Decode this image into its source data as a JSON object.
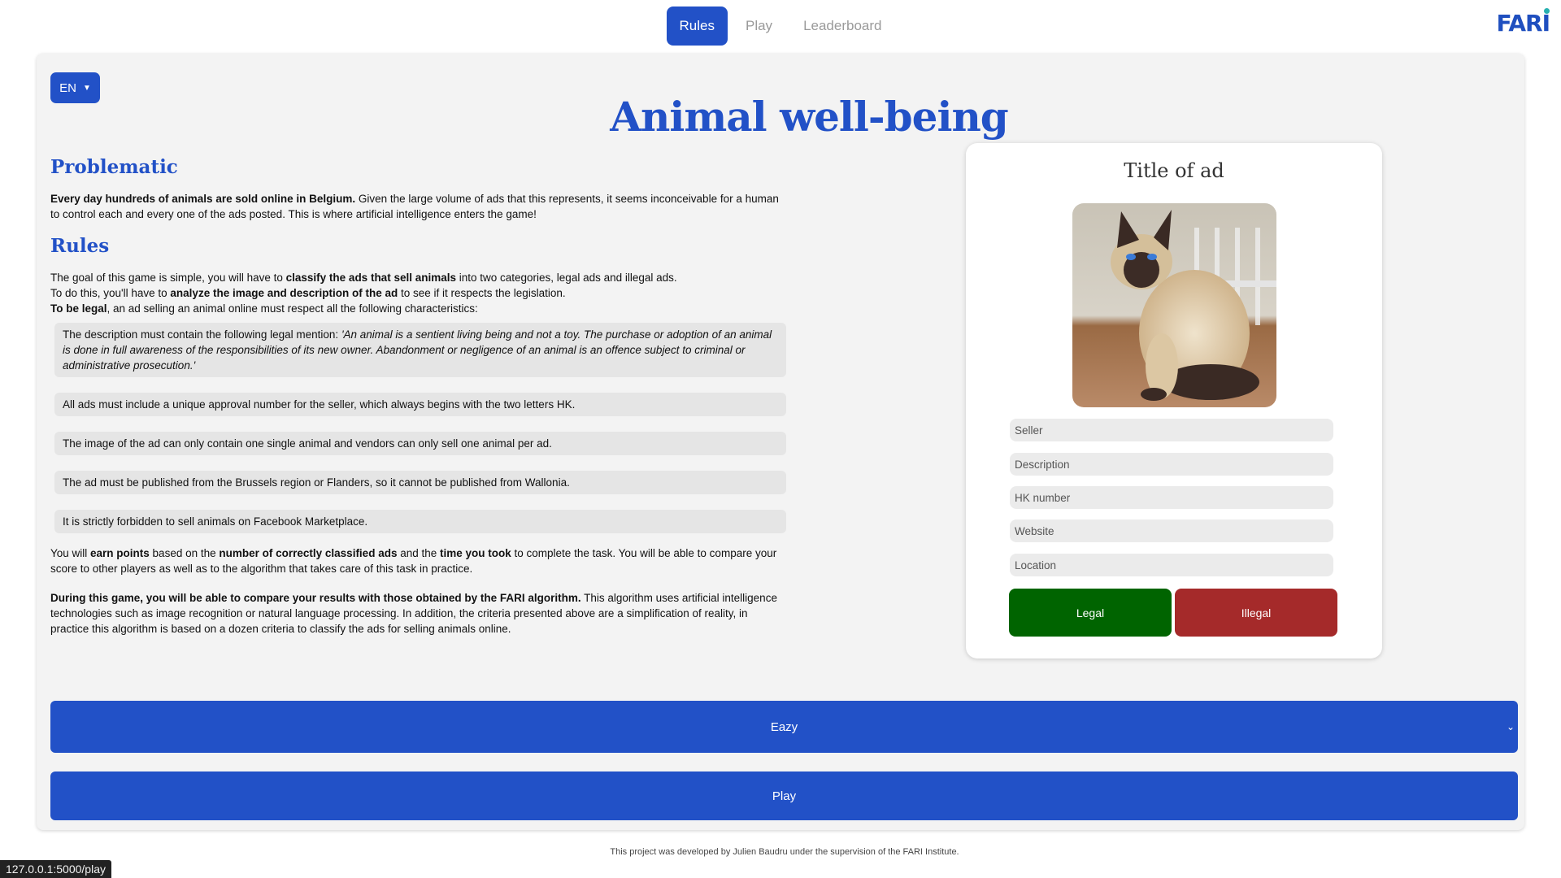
{
  "nav": {
    "tabs": [
      {
        "label": "Rules"
      },
      {
        "label": "Play"
      },
      {
        "label": "Leaderboard"
      }
    ],
    "logo": "FARI"
  },
  "page": {
    "language": "EN",
    "title": "Animal well-being"
  },
  "problematic": {
    "heading": "Problematic",
    "bold": "Every day hundreds of animals are sold online in Belgium.",
    "text": " Given the large volume of ads that this represents, it seems inconceivable for a human to control each and every one of the ads posted. This is where artificial intelligence enters the game!"
  },
  "rules": {
    "heading": "Rules",
    "intro1_a": "The goal of this game is simple, you will have to ",
    "intro1_b": "classify the ads that sell animals",
    "intro1_c": " into two categories, legal ads and illegal ads.",
    "intro2_a": "To do this, you'll have to ",
    "intro2_b": "analyze the image and description of the ad",
    "intro2_c": " to see if it respects the legislation.",
    "intro3_a": "To be legal",
    "intro3_b": ", an ad selling an animal online must respect all the following characteristics:",
    "rule1_a": "The description must contain the following legal mention: ",
    "rule1_b": "'An animal is a sentient living being and not a toy. The purchase or adoption of an animal is done in full awareness of the responsibilities of its new owner. Abandonment or negligence of an animal is an offence subject to criminal or administrative prosecution.'",
    "rule2": "All ads must include a unique approval number for the seller, which always begins with the two letters HK.",
    "rule3": "The image of the ad can only contain one single animal and vendors can only sell one animal per ad.",
    "rule4": "The ad must be published from the Brussels region or Flanders, so it cannot be published from Wallonia.",
    "rule5": "It is strictly forbidden to sell animals on Facebook Marketplace.",
    "points_a": "You will ",
    "points_b": "earn points",
    "points_c": " based on the ",
    "points_d": "number of correctly classified ads",
    "points_e": " and the ",
    "points_f": "time you took",
    "points_g": " to complete the task. You will be able to compare your score to other players as well as to the algorithm that takes care of this task in practice.",
    "compare_a": "During this game, you will be able to compare your results with those obtained by the FARI algorithm.",
    "compare_b": " This algorithm uses artificial intelligence technologies such as image recognition or natural language processing. In addition, the criteria presented above are a simplification of reality, in practice this algorithm is based on a dozen criteria to classify the ads for selling animals online."
  },
  "ad": {
    "title": "Title of ad",
    "fields": {
      "seller": "Seller",
      "description": "Description",
      "hk_number": "HK number",
      "website": "Website",
      "location": "Location"
    },
    "legal_label": "Legal",
    "illegal_label": "Illegal"
  },
  "controls": {
    "difficulty": "Eazy",
    "play_label": "Play"
  },
  "footer": "This project was developed by Julien Baudru under the supervision of the FARI Institute.",
  "status_url": "127.0.0.1:5000/play"
}
